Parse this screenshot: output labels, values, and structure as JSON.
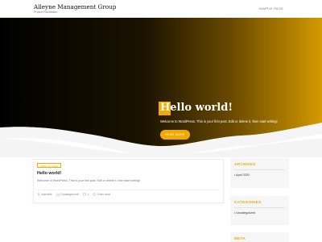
{
  "header": {
    "site_title": "Alleyne Management Group",
    "site_description": "Project Facilitation",
    "nav": [
      "SAMPLE PAGE"
    ]
  },
  "hero": {
    "title": "Hello world!",
    "text": "Welcome to WordPress. This is your first post. Edit or delete it, then start writing!",
    "button_label": "READ MORE",
    "colors": {
      "dark": "#000000",
      "accent": "#f2a900"
    }
  },
  "post": {
    "date": "APRIL 11, 2020",
    "title": "Hello world!",
    "excerpt": "Welcome to WordPress. This is your first post. Edit or delete it, then start writing!",
    "meta": {
      "author": "marcelle",
      "category": "Uncategorized",
      "comments": "1",
      "read_time": "0 sec read"
    }
  },
  "sidebar": {
    "archives": {
      "title": "ARCHIVES",
      "items": [
        "April 2020"
      ]
    },
    "categories": {
      "title": "CATEGORIES",
      "items": [
        "Uncategorized"
      ]
    },
    "meta": {
      "title": "META"
    }
  }
}
